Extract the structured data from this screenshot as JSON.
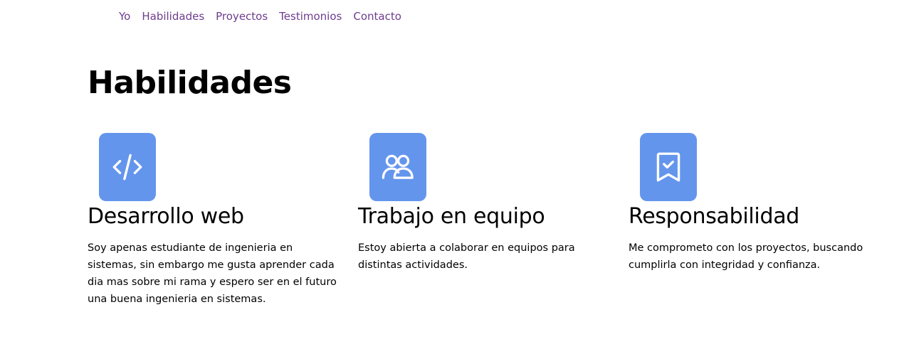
{
  "nav": {
    "items": [
      {
        "label": "Yo"
      },
      {
        "label": "Habilidades"
      },
      {
        "label": "Proyectos"
      },
      {
        "label": "Testimonios"
      },
      {
        "label": "Contacto"
      }
    ],
    "link_color": "#6f3c8f"
  },
  "page": {
    "title": "Habilidades"
  },
  "skills": [
    {
      "icon": "code-icon",
      "title": "Desarrollo web",
      "description": "Soy apenas estudiante de ingenieria en sistemas, sin embargo me gusta aprender cada dia mas sobre mi rama y espero ser en el futuro una buena ingenieria en sistemas."
    },
    {
      "icon": "users-icon",
      "title": "Trabajo en equipo",
      "description": "Estoy abierta a colaborar en equipos para distintas actividades."
    },
    {
      "icon": "bookmark-check-icon",
      "title": "Responsabilidad",
      "description": "Me comprometo con los proyectos, buscando cumplirla con integridad y confianza."
    }
  ],
  "colors": {
    "icon_background": "#6495ed",
    "icon_stroke": "#ffffff"
  }
}
